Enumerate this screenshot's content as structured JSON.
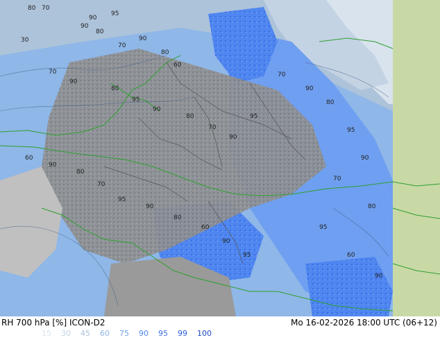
{
  "footer": {
    "title": "RH 700 hPa [%] ICON-D2",
    "datetime": "Mo 16-02-2026 18:00 UTC (06+12)"
  },
  "legend": {
    "values": [
      "15",
      "30",
      "45",
      "60",
      "75",
      "90",
      "95",
      "99",
      "100"
    ],
    "colors": [
      "#d9e3ee",
      "#c3d3e4",
      "#adc3da",
      "#8fb7e8",
      "#6f9ff0",
      "#4f86f0",
      "#3a6fe6",
      "#2a5bd6",
      "#1e47c2"
    ]
  },
  "map": {
    "contour_labels": [
      "80",
      "70",
      "90",
      "95",
      "90",
      "80",
      "70",
      "90",
      "80",
      "60",
      "30",
      "70",
      "90",
      "80",
      "95",
      "90",
      "80",
      "70",
      "90",
      "95",
      "60",
      "90",
      "80",
      "70",
      "95",
      "90",
      "80",
      "60",
      "90",
      "95",
      "70",
      "90",
      "80",
      "95",
      "90",
      "70",
      "80",
      "95",
      "60",
      "90"
    ]
  }
}
